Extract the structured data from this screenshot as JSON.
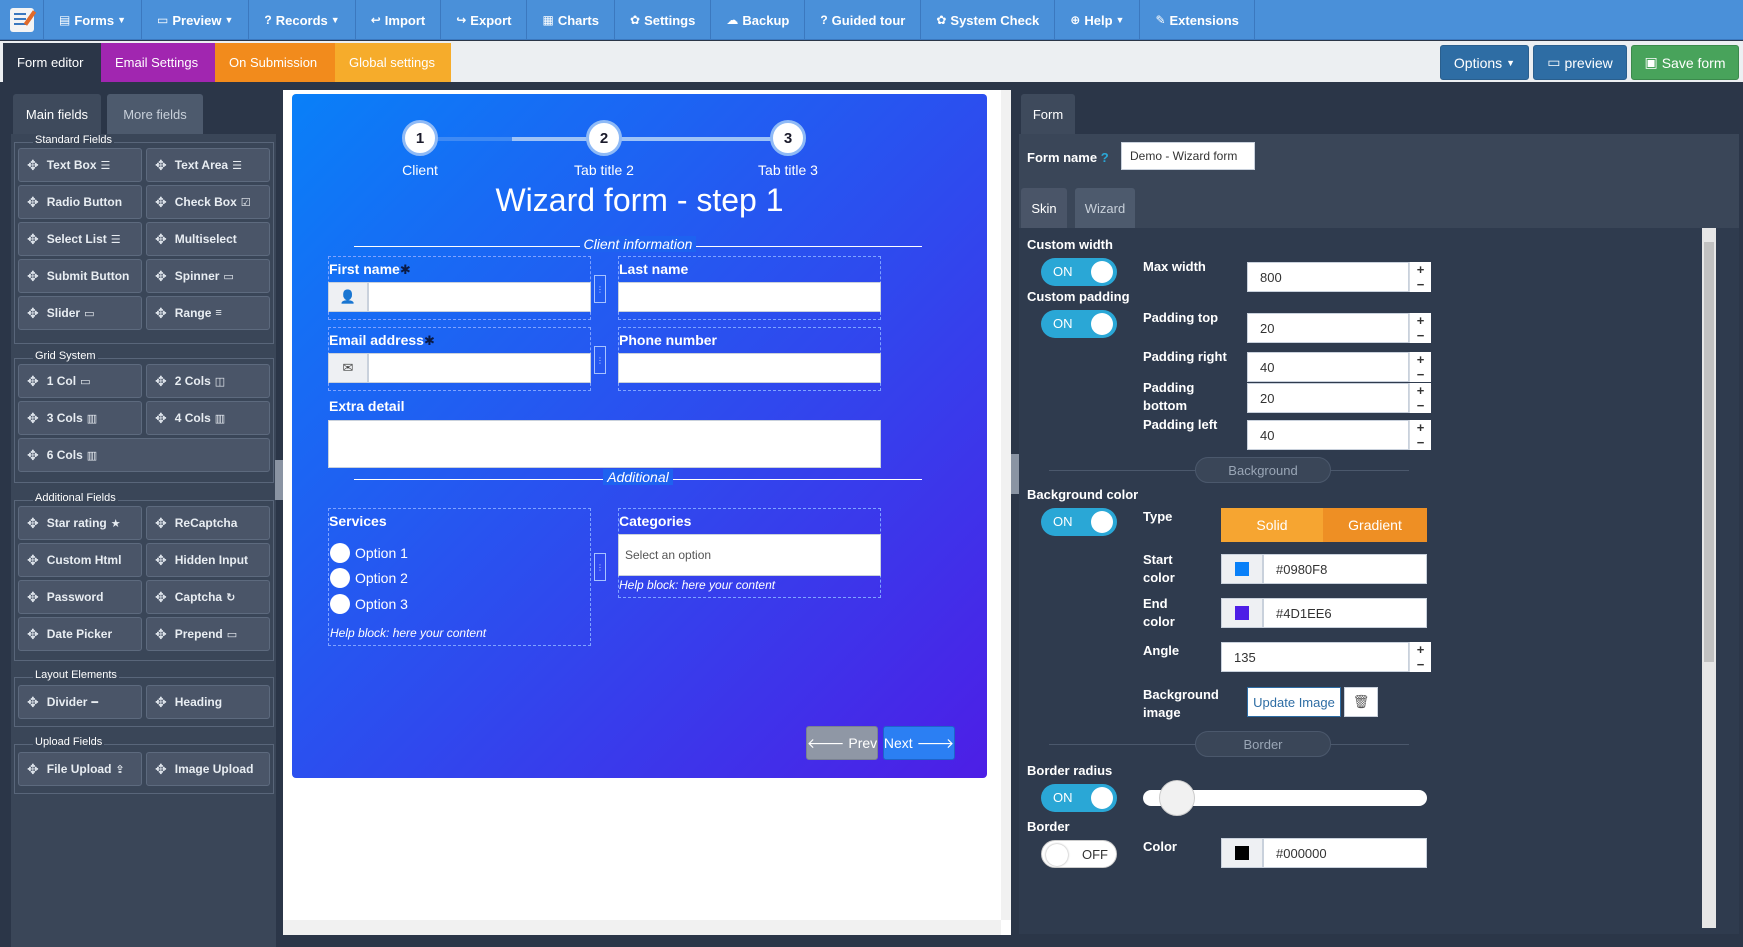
{
  "nav": {
    "items": [
      {
        "icon": "▤",
        "label": "Forms",
        "caret": true
      },
      {
        "icon": "▭",
        "label": "Preview",
        "caret": true
      },
      {
        "icon": "?",
        "label": "Records",
        "caret": true
      },
      {
        "icon": "↩",
        "label": "Import",
        "caret": false
      },
      {
        "icon": "↪",
        "label": "Export",
        "caret": false
      },
      {
        "icon": "▦",
        "label": "Charts",
        "caret": false
      },
      {
        "icon": "✿",
        "label": "Settings",
        "caret": false
      },
      {
        "icon": "☁",
        "label": "Backup",
        "caret": false
      },
      {
        "icon": "?",
        "label": "Guided tour",
        "caret": false
      },
      {
        "icon": "✿",
        "label": "System Check",
        "caret": false
      },
      {
        "icon": "⊕",
        "label": "Help",
        "caret": true
      },
      {
        "icon": "✎",
        "label": "Extensions",
        "caret": false
      }
    ]
  },
  "subbar": {
    "form_editor": "Form editor",
    "email_settings": "Email Settings",
    "on_submission": "On Submission",
    "global_settings": "Global settings",
    "options": "Options",
    "preview": "preview",
    "save": "Save form"
  },
  "left": {
    "tab_main": "Main fields",
    "tab_more": "More fields",
    "groups": {
      "standard": "Standard Fields",
      "grid": "Grid System",
      "additional": "Additional Fields",
      "layout": "Layout Elements",
      "upload": "Upload Fields"
    },
    "fields": {
      "text_box": "Text Box",
      "text_area": "Text Area",
      "radio_button": "Radio Button",
      "check_box": "Check Box",
      "select_list": "Select List",
      "multiselect": "Multiselect",
      "submit_button": "Submit Button",
      "spinner": "Spinner",
      "slider": "Slider",
      "range": "Range",
      "col1": "1 Col",
      "col2": "2 Cols",
      "col3": "3 Cols",
      "col4": "4 Cols",
      "col6": "6 Cols",
      "star_rating": "Star rating",
      "recaptcha": "ReCaptcha",
      "custom_html": "Custom Html",
      "hidden_input": "Hidden Input",
      "password": "Password",
      "captcha": "Captcha",
      "date_picker": "Date Picker",
      "prepend": "Prepend",
      "divider": "Divider",
      "heading": "Heading",
      "file_upload": "File Upload",
      "image_upload": "Image Upload"
    }
  },
  "wizard": {
    "steps": [
      {
        "num": "1",
        "label": "Client"
      },
      {
        "num": "2",
        "label": "Tab title 2"
      },
      {
        "num": "3",
        "label": "Tab title 3"
      }
    ],
    "title": "Wizard form - step 1",
    "section1": "Client information",
    "first_name": "First name",
    "last_name": "Last name",
    "email": "Email address",
    "phone": "Phone number",
    "extra": "Extra detail",
    "section2": "Additional",
    "services": "Services",
    "options": [
      "Option 1",
      "Option 2",
      "Option 3"
    ],
    "help1": "Help block: here your content",
    "categories": "Categories",
    "categories_placeholder": "Select an option",
    "help2": "Help block: here your content",
    "prev": "Prev",
    "next": "Next"
  },
  "right": {
    "tab_form": "Form",
    "form_name_label": "Form name",
    "form_name_value": "Demo - Wizard form",
    "tab_skin": "Skin",
    "tab_wizard": "Wizard",
    "custom_width": "Custom width",
    "custom_padding": "Custom padding",
    "on": "ON",
    "off": "OFF",
    "max_width": "Max width",
    "max_width_value": "800",
    "padding_top": "Padding top",
    "padding_top_value": "20",
    "padding_right": "Padding right",
    "padding_right_value": "40",
    "padding_bottom": "Padding bottom",
    "padding_bottom_value": "20",
    "padding_left": "Padding left",
    "padding_left_value": "40",
    "background_sep": "Background",
    "background_color": "Background color",
    "type": "Type",
    "solid": "Solid",
    "gradient": "Gradient",
    "start_color": "Start color",
    "start_color_value": "#0980F8",
    "end_color": "End color",
    "end_color_value": "#4D1EE6",
    "angle": "Angle",
    "angle_value": "135",
    "background_image": "Background image",
    "update_image": "Update Image",
    "border_sep": "Border",
    "border_radius": "Border radius",
    "border": "Border",
    "color": "Color",
    "color_value": "#000000"
  },
  "colors": {
    "start_swatch": "#0980F8",
    "end_swatch": "#4D1EE6",
    "border_swatch": "#000000"
  }
}
